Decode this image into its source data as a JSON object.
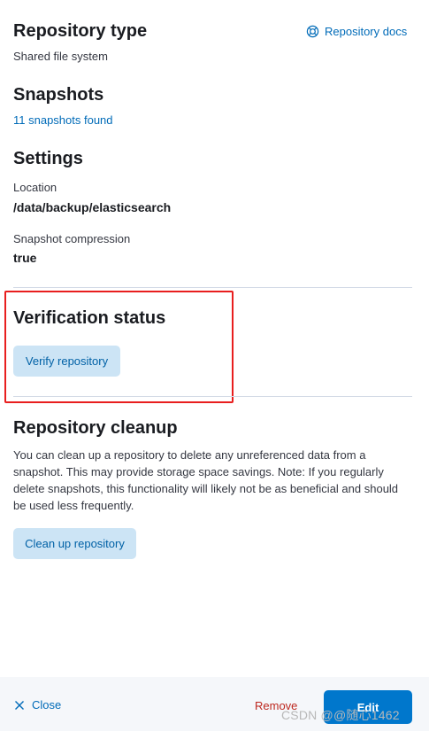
{
  "repository_type": {
    "heading": "Repository type",
    "value": "Shared file system",
    "docs_link": "Repository docs",
    "docs_icon": "help-circle-icon"
  },
  "snapshots": {
    "heading": "Snapshots",
    "link": "11 snapshots found"
  },
  "settings": {
    "heading": "Settings",
    "location_label": "Location",
    "location_value": "/data/backup/elasticsearch",
    "compression_label": "Snapshot compression",
    "compression_value": "true"
  },
  "verification": {
    "heading": "Verification status",
    "verify_button": "Verify repository"
  },
  "cleanup": {
    "heading": "Repository cleanup",
    "description": "You can clean up a repository to delete any unreferenced data from a snapshot. This may provide storage space savings. Note: If you regularly delete snapshots, this functionality will likely not be as beneficial and should be used less frequently.",
    "button": "Clean up repository"
  },
  "footer": {
    "close_label": "Close",
    "close_icon": "close-icon",
    "remove_label": "Remove",
    "edit_label": "Edit"
  },
  "watermark": "CSDN @@随心1462",
  "colors": {
    "link": "#006bb8",
    "danger": "#bd271e",
    "primary": "#0077cc",
    "button_bg": "#cce4f5",
    "highlight": "#e81e1e"
  }
}
